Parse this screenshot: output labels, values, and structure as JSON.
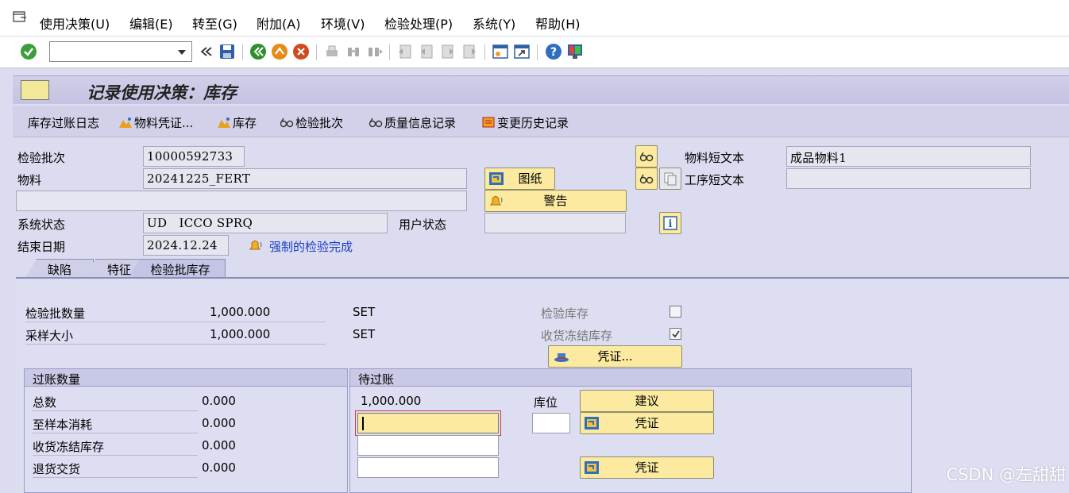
{
  "menu": {
    "items": [
      "使用决策(U)",
      "编辑(E)",
      "转至(G)",
      "附加(A)",
      "环境(V)",
      "检验处理(P)",
      "系统(Y)",
      "帮助(H)"
    ]
  },
  "toolbar": {
    "command_value": "",
    "icons": [
      "enter-check",
      "command-field",
      "back-double-arrow",
      "save",
      "back-green",
      "exit-orange",
      "cancel-red",
      "print",
      "find",
      "find-next",
      "first-page",
      "prev-page",
      "next-page",
      "last-page",
      "new-session",
      "shortcut",
      "help",
      "customize-layout"
    ]
  },
  "title": "记录使用决策：库存",
  "app_toolbar": {
    "stock_posting_log": "库存过账日志",
    "material_document": "物料凭证...",
    "stock": "库存",
    "inspection_lot": "检验批次",
    "quality_info_record": "质量信息记录",
    "change_history": "变更历史记录"
  },
  "header": {
    "inspection_lot_label": "检验批次",
    "inspection_lot_value": "10000592733",
    "material_label": "物料",
    "material_value": "20241225_FERT",
    "extra_value": "",
    "system_status_label": "系统状态",
    "system_status_value": "UD   ICCO SPRQ",
    "user_status_label": "用户状态",
    "user_status_value": "",
    "end_date_label": "结束日期",
    "end_date_value": "2024.12.24",
    "forced_completion_link": "强制的检验完成",
    "drawing_button": "图纸",
    "warning_button": "警告",
    "material_short_text_label": "物料短文本",
    "material_short_text_value": "成品物料1",
    "operation_short_text_label": "工序短文本",
    "operation_short_text_value": ""
  },
  "tabs": [
    "缺陷",
    "特征",
    "检验批库存"
  ],
  "lot_stock": {
    "lot_qty_label": "检验批数量",
    "lot_qty_value": "1,000.000",
    "lot_qty_unit": "SET",
    "sample_size_label": "采样大小",
    "sample_size_value": "1,000.000",
    "sample_size_unit": "SET",
    "insp_stock_label": "检验库存",
    "insp_stock_checked": false,
    "gr_blocked_label": "收货冻结库存",
    "gr_blocked_checked": true,
    "document_button": "凭证..."
  },
  "posted_qty": {
    "title": "过账数量",
    "rows": [
      {
        "label": "总数",
        "value": "0.000"
      },
      {
        "label": "至样本消耗",
        "value": "0.000"
      },
      {
        "label": "收货冻结库存",
        "value": "0.000"
      },
      {
        "label": "退货交货",
        "value": "0.000"
      }
    ]
  },
  "to_be_posted": {
    "title": "待过账",
    "total_value": "1,000.000",
    "storage_bin_label": "库位",
    "suggest_button": "建议",
    "document_button_1": "凭证",
    "document_button_2": "凭证"
  },
  "watermark": "CSDN @左甜甜",
  "colors": {
    "button_yellow": "#fbeaa0",
    "link_blue": "#1a3fc4",
    "panel": "#dedef2"
  }
}
